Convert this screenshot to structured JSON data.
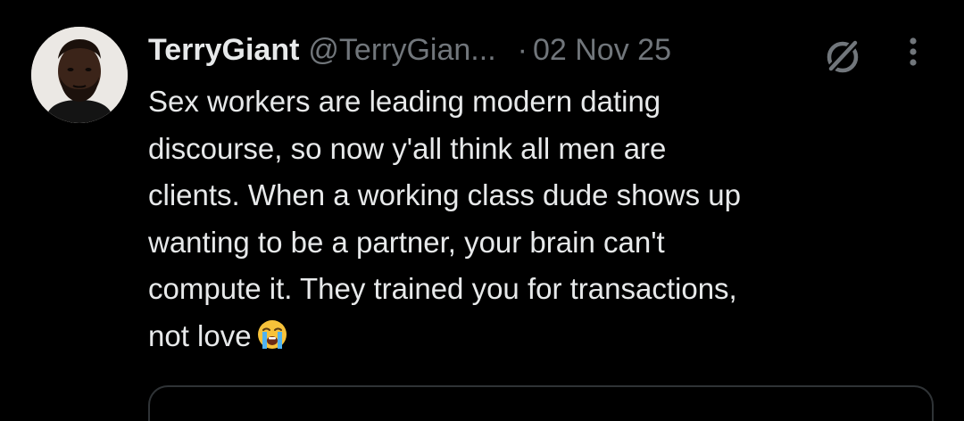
{
  "tweet": {
    "author": {
      "display_name": "TerryGiant",
      "handle": "@TerryGian...",
      "avatar_icon": "profile-photo"
    },
    "separator": "·",
    "date": "02 Nov 25",
    "text": "Sex workers are leading modern dating\ndiscourse, so now y'all think all men are\nclients. When a working class dude shows up\nwanting to be a partner, your brain can't\ncompute it. They trained you for transactions,\nnot love",
    "emoji": "loudly-crying-face",
    "actions": {
      "grok_icon": "grok-icon",
      "more_icon": "more-options-icon"
    }
  },
  "colors": {
    "background": "#000000",
    "primary_text": "#e7e9ea",
    "secondary_text": "#71767b",
    "border": "#2f3336"
  }
}
